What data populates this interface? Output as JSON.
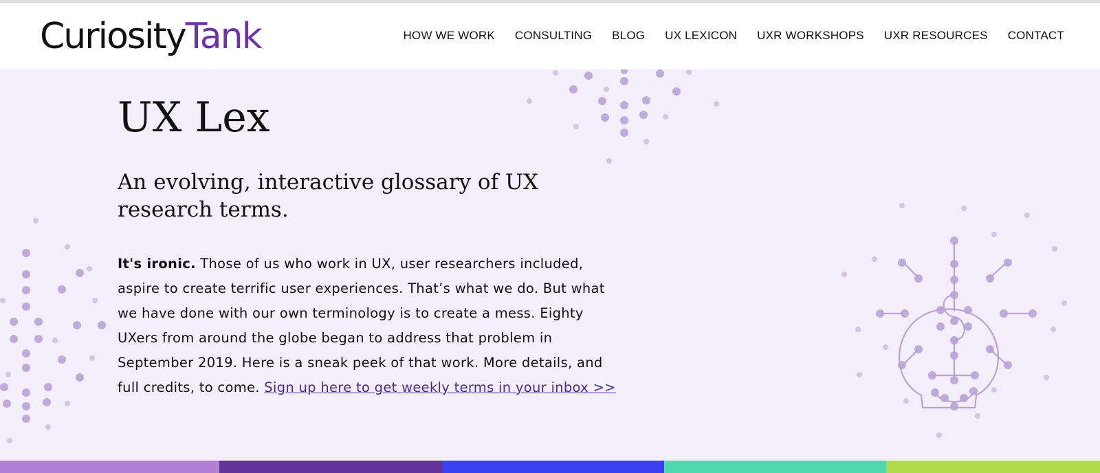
{
  "header": {
    "logo_part1": "Curiosity",
    "logo_part2": "Tank",
    "nav": [
      "HOW WE WORK",
      "CONSULTING",
      "BLOG",
      "UX LEXICON",
      "UXR WORKSHOPS",
      "UXR RESOURCES",
      "CONTACT"
    ]
  },
  "hero": {
    "title": "UX Lex",
    "subtitle": "An evolving, interactive glossary of UX research terms.",
    "intro_bold": "It's ironic.",
    "intro_text": " Those of us who work in UX, user researchers included, aspire to create terrific user experiences. That’s what we do. But what we have done with our own terminology is to create a mess. Eighty UXers from around the globe began to address that problem in September 2019. Here is a sneak peek of that work. More details, and full credits, to come. ",
    "signup_link": "Sign up here to get weekly terms in your inbox >>"
  },
  "colors": {
    "brand_purple": "#6a35a6",
    "hero_bg": "#f3eef9",
    "dots": "#b9a3d6",
    "bar": [
      "#b47fd6",
      "#633399",
      "#3a3ff0",
      "#4fd9ac",
      "#b2d94a"
    ]
  },
  "icons": [
    "lightbulb-icon",
    "magnifier-icon"
  ]
}
